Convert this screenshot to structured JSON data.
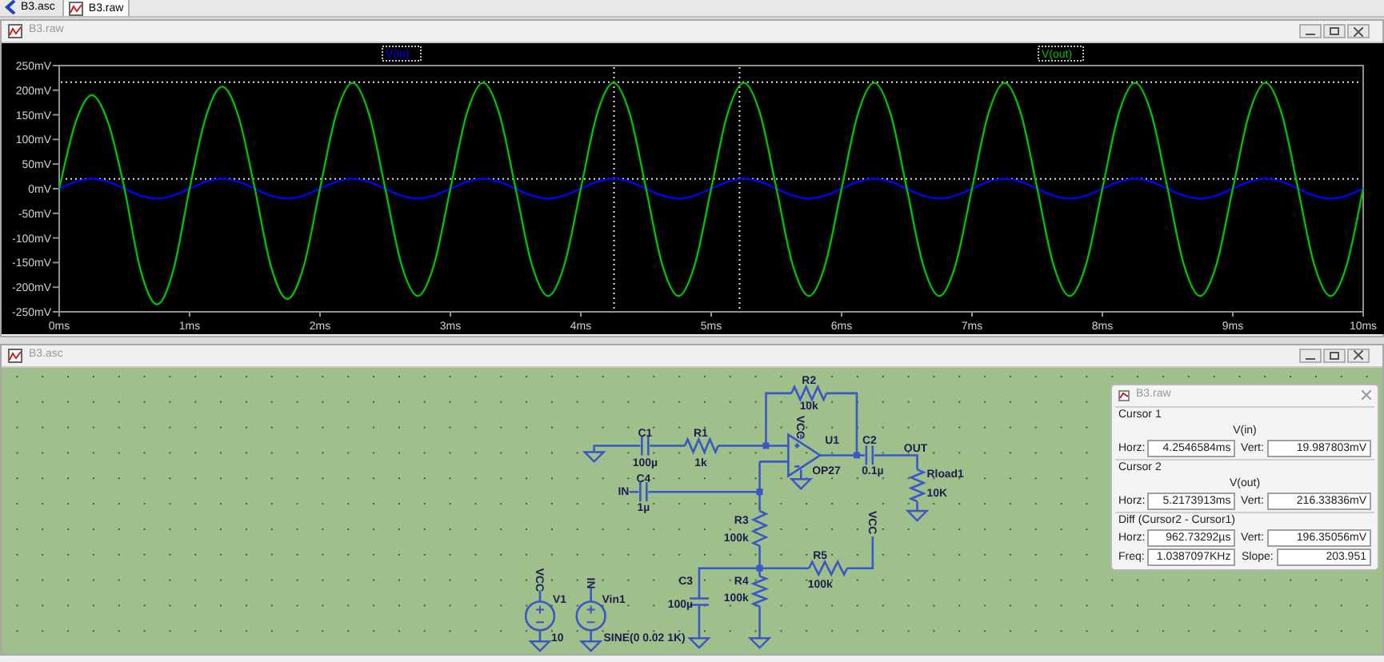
{
  "tabs": [
    {
      "kind": "schematic",
      "label": "B3.asc",
      "selected": false
    },
    {
      "kind": "waveform",
      "label": "B3.raw",
      "selected": true
    }
  ],
  "plot_window": {
    "title": "B3.raw",
    "chart_data": {
      "type": "line",
      "x": [
        0,
        0.125,
        0.25,
        0.375,
        0.5,
        0.625,
        0.75,
        0.875,
        1,
        1.125,
        1.25,
        1.375,
        1.5,
        1.625,
        1.75,
        1.875,
        2,
        2.125,
        2.25,
        2.375,
        2.5,
        2.625,
        2.75,
        2.875,
        3,
        3.125,
        3.25,
        3.375,
        3.5,
        3.625,
        3.75,
        3.875,
        4,
        4.125,
        4.25,
        4.375,
        4.5,
        4.625,
        4.75,
        4.875,
        5,
        5.125,
        5.25,
        5.375,
        5.5,
        5.625,
        5.75,
        5.875,
        6,
        6.125,
        6.25,
        6.375,
        6.5,
        6.625,
        6.75,
        6.875,
        7,
        7.125,
        7.25,
        7.375,
        7.5,
        7.625,
        7.75,
        7.875,
        8,
        8.125,
        8.25,
        8.375,
        8.5,
        8.625,
        8.75,
        8.875,
        9,
        9.125,
        9.25,
        9.375,
        9.5,
        9.625,
        9.75,
        9.875,
        10
      ],
      "series": [
        {
          "name": "V(in)",
          "color": "#0000ff",
          "values": [
            0,
            14,
            20,
            14,
            0,
            -14,
            -20,
            -14,
            0,
            14,
            20,
            14,
            0,
            -14,
            -20,
            -14,
            0,
            14,
            20,
            14,
            0,
            -14,
            -20,
            -14,
            0,
            14,
            20,
            14,
            0,
            -14,
            -20,
            -14,
            0,
            14,
            20,
            14,
            0,
            -14,
            -20,
            -14,
            0,
            14,
            20,
            14,
            0,
            -14,
            -20,
            -14,
            0,
            14,
            20,
            14,
            0,
            -14,
            -20,
            -14,
            0,
            14,
            20,
            14,
            0,
            -14,
            -20,
            -14,
            0,
            14,
            20,
            14,
            0,
            -14,
            -20,
            -14,
            0,
            14,
            20,
            14,
            0,
            -14,
            -20,
            -14,
            0
          ]
        },
        {
          "name": "V(out)",
          "color": "#00c000",
          "values": [
            0,
            134,
            190,
            134,
            0,
            -166,
            -235,
            -166,
            0,
            146,
            207,
            146,
            0,
            -158,
            -224,
            -158,
            0,
            152,
            215,
            152,
            0,
            -154,
            -218,
            -154,
            0,
            152,
            215,
            152,
            0,
            -154,
            -218,
            -154,
            0,
            152,
            215,
            152,
            0,
            -154,
            -218,
            -154,
            0,
            152,
            215,
            152,
            0,
            -154,
            -218,
            -154,
            0,
            152,
            215,
            152,
            0,
            -154,
            -218,
            -154,
            0,
            152,
            215,
            152,
            0,
            -154,
            -218,
            -154,
            0,
            152,
            215,
            152,
            0,
            -154,
            -218,
            -154,
            0,
            152,
            215,
            152,
            0,
            -154,
            -218,
            -154,
            0
          ]
        }
      ],
      "xlim": [
        0,
        10
      ],
      "ylim": [
        -250,
        250
      ],
      "xticks": [
        {
          "value": 0,
          "label": "0ms"
        },
        {
          "value": 1,
          "label": "1ms"
        },
        {
          "value": 2,
          "label": "2ms"
        },
        {
          "value": 3,
          "label": "3ms"
        },
        {
          "value": 4,
          "label": "4ms"
        },
        {
          "value": 5,
          "label": "5ms"
        },
        {
          "value": 6,
          "label": "6ms"
        },
        {
          "value": 7,
          "label": "7ms"
        },
        {
          "value": 8,
          "label": "8ms"
        },
        {
          "value": 9,
          "label": "9ms"
        },
        {
          "value": 10,
          "label": "10ms"
        }
      ],
      "yticks": [
        {
          "value": 250,
          "label": "250mV"
        },
        {
          "value": 200,
          "label": "200mV"
        },
        {
          "value": 150,
          "label": "150mV"
        },
        {
          "value": 100,
          "label": "100mV"
        },
        {
          "value": 50,
          "label": "50mV"
        },
        {
          "value": 0,
          "label": "0mV"
        },
        {
          "value": -50,
          "label": "-50mV"
        },
        {
          "value": -100,
          "label": "-100mV"
        },
        {
          "value": -150,
          "label": "-150mV"
        },
        {
          "value": -200,
          "label": "-200mV"
        },
        {
          "value": -250,
          "label": "-250mV"
        }
      ]
    }
  },
  "schematic_window": {
    "title": "B3.asc",
    "components": [
      {
        "kind": "resistor",
        "name": "R2",
        "value": "10k"
      },
      {
        "kind": "capacitor",
        "name": "C1",
        "value": "100µ"
      },
      {
        "kind": "resistor",
        "name": "R1",
        "value": "1k"
      },
      {
        "kind": "opamp",
        "name": "U1",
        "value": "OP27"
      },
      {
        "kind": "capacitor",
        "name": "C2",
        "value": "0.1µ"
      },
      {
        "kind": "capacitor",
        "name": "C4",
        "value": "1µ"
      },
      {
        "kind": "resistor",
        "name": "Rload1",
        "value": "10K"
      },
      {
        "kind": "resistor",
        "name": "R3",
        "value": "100k"
      },
      {
        "kind": "resistor",
        "name": "R5",
        "value": "100k"
      },
      {
        "kind": "capacitor",
        "name": "C3",
        "value": "100µ"
      },
      {
        "kind": "resistor",
        "name": "R4",
        "value": "100k"
      },
      {
        "kind": "source",
        "name": "V1",
        "value": "10"
      },
      {
        "kind": "source",
        "name": "Vin1",
        "value": "SINE(0 0.02 1K)"
      }
    ],
    "net_labels": [
      {
        "kind": "horizontal",
        "text": "OUT"
      },
      {
        "kind": "horizontal",
        "text": "IN"
      },
      {
        "kind": "vertical",
        "text": "VCC"
      },
      {
        "kind": "vertical",
        "text": "VCC"
      },
      {
        "kind": "vertical",
        "text": "VCC"
      },
      {
        "kind": "vertical",
        "text": "IN"
      }
    ],
    "cursor_dialog": {
      "title": "B3.raw",
      "cursors": [
        {
          "label": "Cursor 1",
          "trace": "V(in)",
          "horz_label": "Horz:",
          "horz": "4.2546584ms",
          "vert_label": "Vert:",
          "vert": "19.987803mV"
        },
        {
          "label": "Cursor 2",
          "trace": "V(out)",
          "horz_label": "Horz:",
          "horz": "5.2173913ms",
          "vert_label": "Vert:",
          "vert": "216.33836mV"
        }
      ],
      "diff": {
        "label": "Diff (Cursor2 - Cursor1)",
        "horz_label": "Horz:",
        "horz": "962.73292µs",
        "vert_label": "Vert:",
        "vert": "196.35056mV",
        "freq_label": "Freq:",
        "freq": "1.0387097KHz",
        "slope_label": "Slope:",
        "slope": "203.951"
      }
    }
  }
}
